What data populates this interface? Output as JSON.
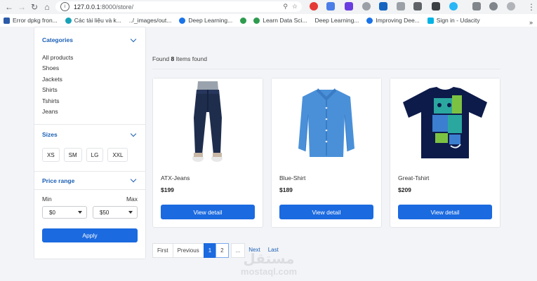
{
  "browser": {
    "url_host": "127.0.0.1",
    "url_path": ":8000/store/",
    "bookmarks": [
      {
        "label": "Error dpkg fron...",
        "color": "#2b5aa8"
      },
      {
        "label": "Các tài liệu và k...",
        "color": "#17a2b8"
      },
      {
        "label": "../_images/out...",
        "color": "#5f6368"
      },
      {
        "label": "Deep Learning...",
        "color": "#1a73e8"
      },
      {
        "label": "",
        "color": "#2e9b4f"
      },
      {
        "label": "Learn Data Sci...",
        "color": "#2e9b4f"
      },
      {
        "label": "Deep Learning...",
        "color": "#5f6368"
      },
      {
        "label": "Improving Dee...",
        "color": "#1a73e8"
      },
      {
        "label": "Sign in - Udacity",
        "color": "#02b3e4"
      }
    ],
    "more_label": "»"
  },
  "sidebar": {
    "categories_title": "Categories",
    "categories": [
      "All products",
      "Shoes",
      "Jackets",
      "Shirts",
      "Tshirts",
      "Jeans"
    ],
    "sizes_title": "Sizes",
    "sizes": [
      "XS",
      "SM",
      "LG",
      "XXL"
    ],
    "price_title": "Price range",
    "min_label": "Min",
    "max_label": "Max",
    "min_value": "$0",
    "max_value": "$50",
    "apply_label": "Apply"
  },
  "results": {
    "prefix": "Found ",
    "count": "8",
    "suffix": " Items found"
  },
  "products": [
    {
      "name": "ATX-Jeans",
      "price": "$199",
      "button": "View detail",
      "icon": "jeans-image"
    },
    {
      "name": "Blue-Shirt",
      "price": "$189",
      "button": "View detail",
      "icon": "shirt-image"
    },
    {
      "name": "Great-Tshirt",
      "price": "$209",
      "button": "View detail",
      "icon": "tshirt-image"
    }
  ],
  "pagination": {
    "first": "First",
    "previous": "Previous",
    "pages": [
      "1",
      "2"
    ],
    "ellipsis": "...",
    "next": "Next",
    "last": "Last"
  },
  "watermark": {
    "arabic": "مستقل",
    "latin": "mostaql.com"
  },
  "colors": {
    "accent": "#1b6ae0",
    "heading": "#1a5fb4",
    "jeans": "#1f2d4d",
    "shirt": "#4a90d9",
    "tshirt": "#0d1b4a"
  }
}
